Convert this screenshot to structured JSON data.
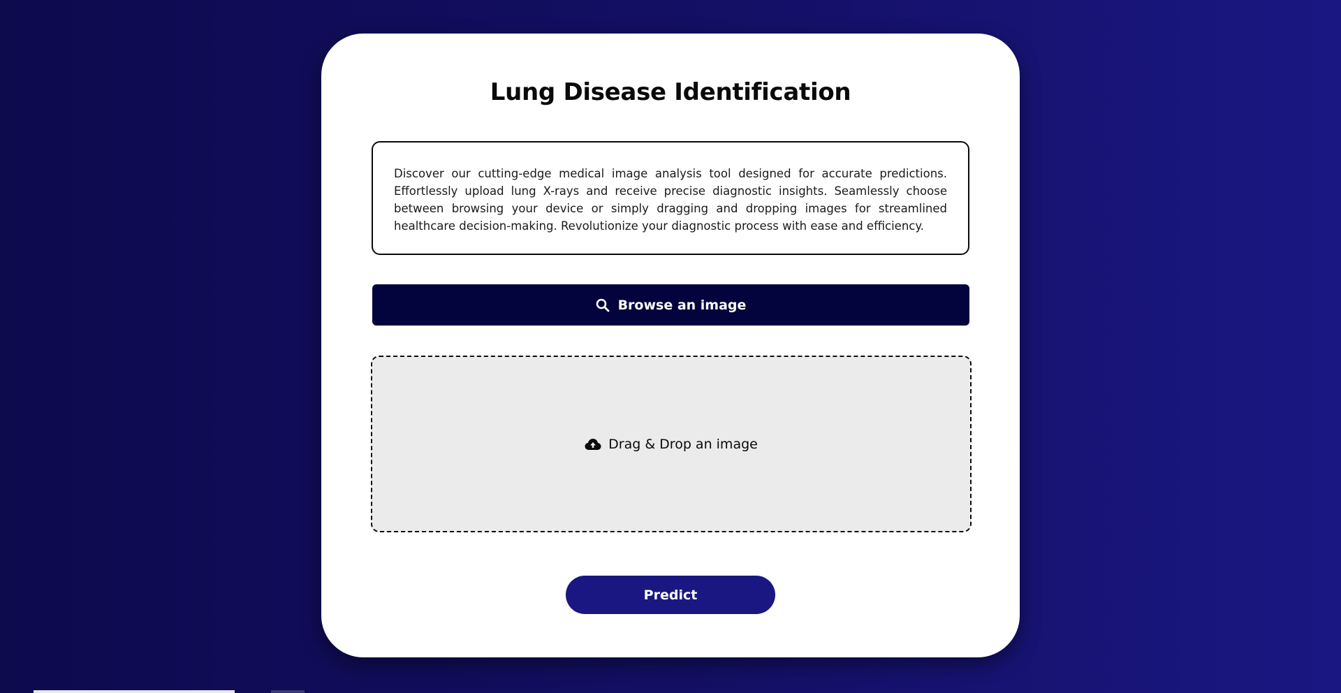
{
  "page": {
    "title": "Lung Disease Identification",
    "description": "Discover our cutting-edge medical image analysis tool designed for accurate predictions. Effortlessly upload lung X-rays and receive precise diagnostic insights. Seamlessly choose between browsing your device or simply dragging and dropping images for streamlined healthcare decision-making. Revolutionize your diagnostic process with ease and efficiency."
  },
  "browse": {
    "label": "Browse an image",
    "icon": "search-icon"
  },
  "dropzone": {
    "label": "Drag & Drop an image",
    "icon": "cloud-upload-icon"
  },
  "predict": {
    "label": "Predict"
  },
  "colors": {
    "background_start": "#0e0a4e",
    "background_end": "#1a1782",
    "browse_button": "#03033d",
    "predict_button": "#1a1782",
    "dropzone_fill": "#ebebeb"
  }
}
